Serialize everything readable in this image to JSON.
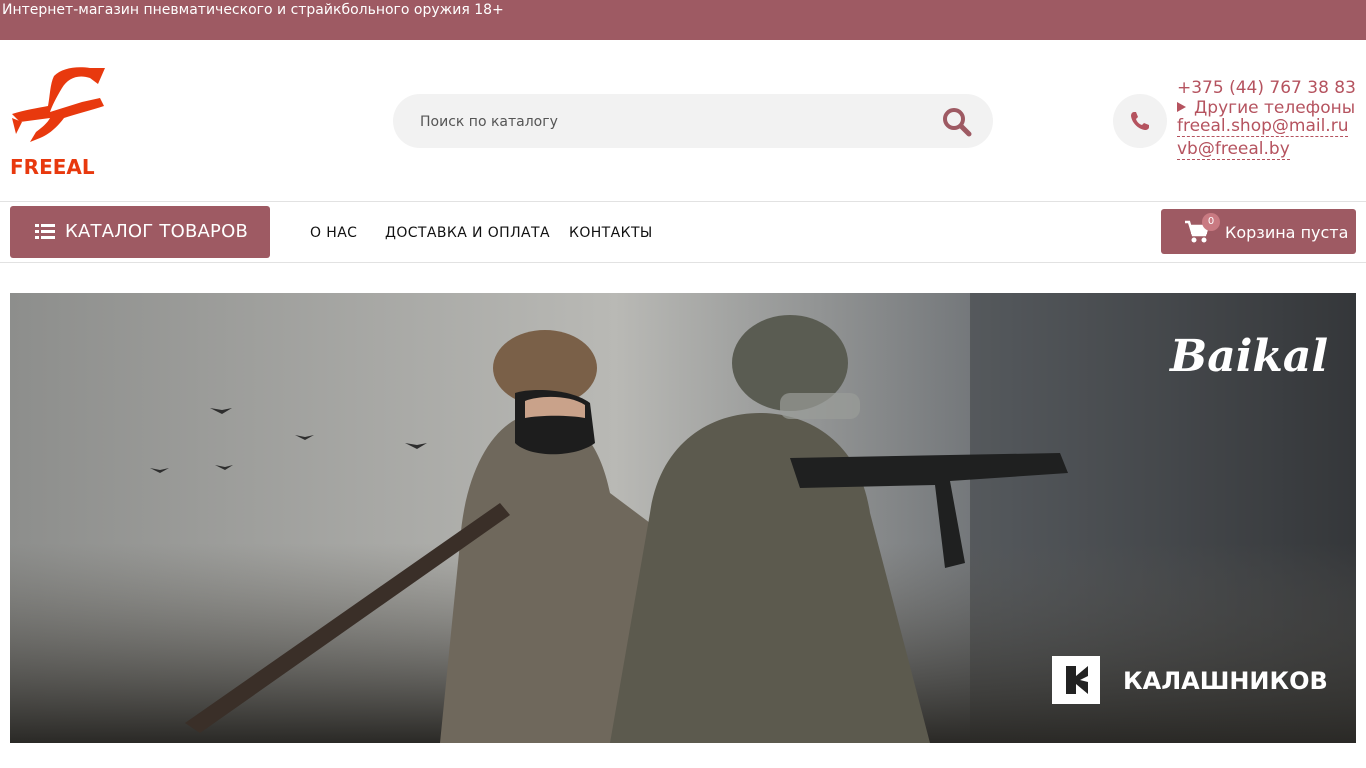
{
  "topbar": {
    "text": "Интернет-магазин пневматического и страйкбольного оружия 18+"
  },
  "logo": {
    "text": "FREEAL",
    "color": "#e8390e"
  },
  "search": {
    "placeholder": "Поиск по каталогу",
    "icon": "search-icon"
  },
  "contacts": {
    "phone": "+375 (44) 767 38 83",
    "other_phones": "Другие телефоны",
    "email1": "freeal.shop@mail.ru",
    "email2": "vb@freeal.by",
    "icon": "phone-icon"
  },
  "catalog": {
    "label": "КАТАЛОГ ТОВАРОВ",
    "icon": "list-icon"
  },
  "nav": {
    "about": "О НАС",
    "delivery": "ДОСТАВКА И ОПЛАТА",
    "contacts": "КОНТАКТЫ"
  },
  "cart": {
    "count": "0",
    "label": "Корзина пуста",
    "icon": "cart-icon"
  },
  "banner": {
    "brand1": "Baikal",
    "brand2": "КАЛАШНИКОВ"
  },
  "colors": {
    "accent": "#9e5a63",
    "link": "#b5535f",
    "logo": "#e8390e"
  }
}
